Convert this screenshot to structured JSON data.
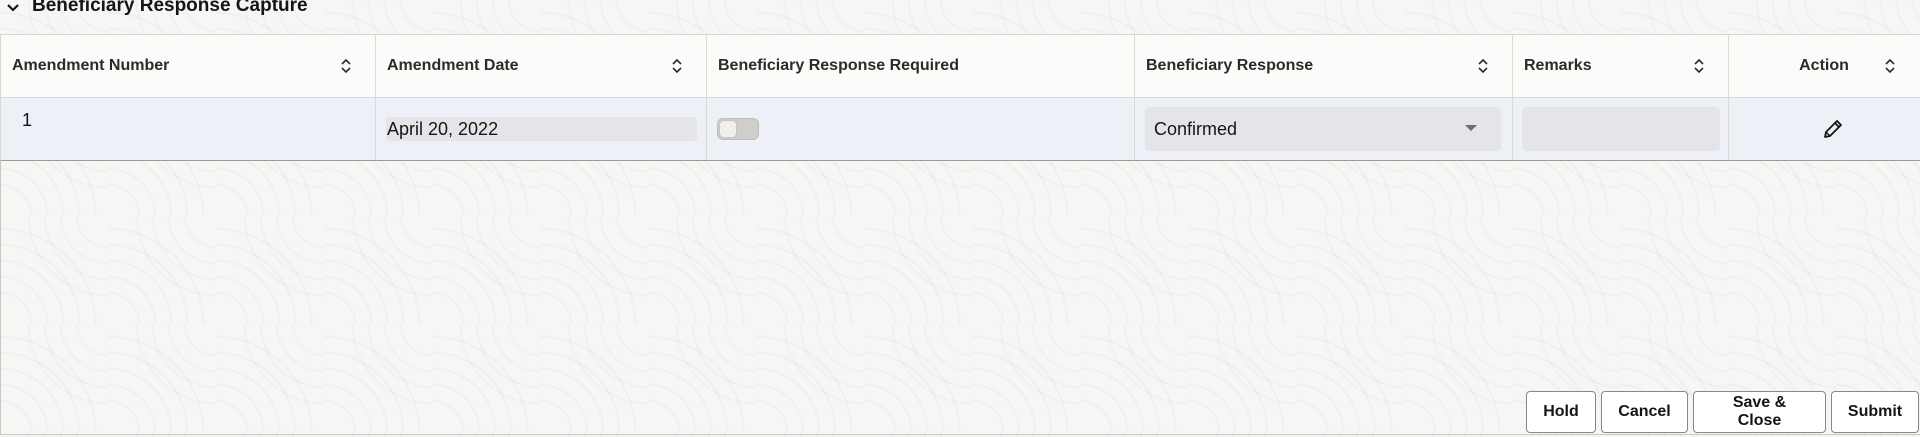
{
  "section": {
    "title": "Beneficiary Response Capture"
  },
  "table": {
    "columns": [
      "Amendment Number",
      "Amendment Date",
      "Beneficiary Response Required",
      "Beneficiary Response",
      "Remarks",
      "Action"
    ],
    "rows": [
      {
        "amendment_number": "1",
        "amendment_date": "April 20, 2022",
        "response_required": false,
        "beneficiary_response": "Confirmed",
        "remarks": ""
      }
    ]
  },
  "footer": {
    "hold": "Hold",
    "cancel": "Cancel",
    "save_close": "Save & Close",
    "submit": "Submit"
  },
  "icons": {
    "collapse": "chevron-down-icon",
    "sort": "sort-icon",
    "edit": "pencil-icon"
  }
}
